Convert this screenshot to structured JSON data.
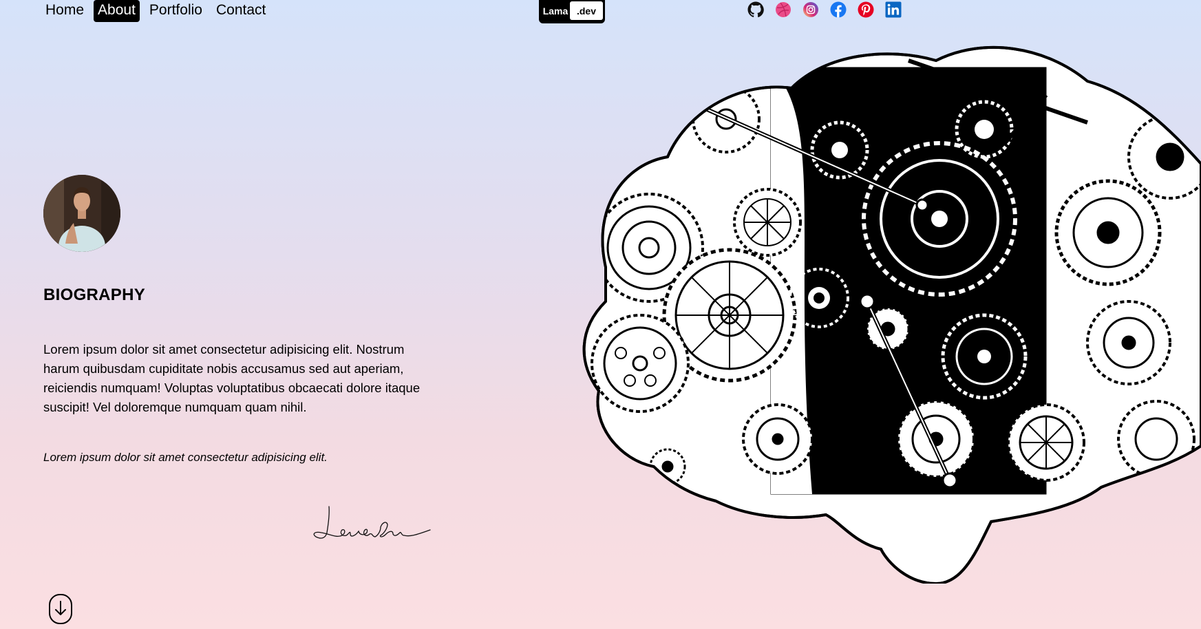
{
  "nav": {
    "links": [
      {
        "label": "Home"
      },
      {
        "label": "About",
        "active": true
      },
      {
        "label": "Portfolio"
      },
      {
        "label": "Contact"
      }
    ],
    "logo": {
      "left": "Lama",
      "right": ".dev"
    },
    "socials": [
      "github-icon",
      "dribbble-icon",
      "instagram-icon",
      "facebook-icon",
      "pinterest-icon",
      "linkedin-icon"
    ]
  },
  "biography": {
    "title": "BIOGRAPHY",
    "text": "Lorem ipsum dolor sit amet consectetur adipisicing elit. Nostrum harum quibusdam cupiditate nobis accusamus sed aut aperiam, reiciendis numquam! Voluptas voluptatibus obcaecati dolore itaque suscipit! Vel doloremque numquam quam nihil.",
    "quote": "Lorem ipsum dolor sit amet consectetur adipisicing elit.",
    "signature": "Lama dev"
  },
  "colors": {
    "bg_top": "#d5e3fa",
    "bg_bottom": "#fbdfe2",
    "dribbble": "#ea4c89",
    "instagram": "#d62976",
    "facebook": "#1877f2",
    "pinterest": "#e60023",
    "linkedin": "#0a66c2"
  }
}
